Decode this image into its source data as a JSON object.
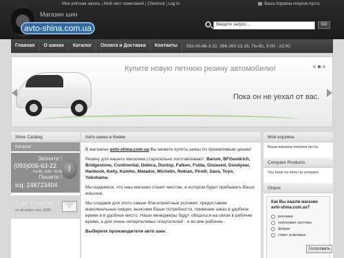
{
  "header": {
    "top_links": [
      "Моя учётная запись",
      "Мой лист пожеланий",
      "Checkout",
      "Log In"
    ],
    "cart_text": "Ваша Корзина покупок пуста.",
    "logo_subtitle": "Магазин шин",
    "logo_main": "avto-shina.com.ua",
    "search_placeholder": "Введите запрос...",
    "go_label": "GO"
  },
  "nav": {
    "items": [
      "Главная",
      "О шинах",
      "Каталог",
      "Оплата и Доставка",
      "Контакты"
    ],
    "info": "093-00-66-3-22, 066-260-13-26, Пн-Вс, 9:00 - 22:00"
  },
  "banner": {
    "line1": "Купите новую летнюю резину автомобилю!",
    "line2": "Пока он не уехал от вас."
  },
  "left": {
    "store_catalog": "Store Catalog",
    "catalog": "Каталог",
    "call": "Звоните !",
    "phone": "(093)006-63-22",
    "hours": "Пн-Вс, 9:00 - 22:00",
    "write": "Пишите !",
    "icq": "icq: 248723404",
    "ship_title": "Free shipping",
    "ship_sub": "on all orders over 100$"
  },
  "center": {
    "heading": "Авто шины в Киеве",
    "p1_pre": "В магазине ",
    "p1_link": "avto-shina.com.ua",
    "p1_post": " Вы можете купить шины по приемлимым ценам!",
    "p2_pre": "Резину для нашего магазина старательно изготавливают: ",
    "p2_brands": "Barum, BFGoodrich, Bridgestone, Continental, Debica, Dunlop, Falken, Fulda, Gislaved, Goodyear, Hankook, Kelly, Kumho, Matador, Michelin, Nokian, Pirelli, Sava, Toyo, Yokohama",
    "p2_post": ".",
    "p3_pre": "Мы надеемся, что наш магазин станет  местом, в котором будет пребывать ",
    "p3_em": "Ваша машина",
    "p3_post": ".",
    "p4": "Мы создаем для этого самые благоприятные условия: предоставим максимальные скидки, выясним Ваши потребности, привезем заказ в удобное время и в удобное место. Наши менеджеры будут общаться на связи в рабочее время, а для очень нетерпеливых покупателей - и во вне рабочее.",
    "choose": "Выберите производителя авто шин:"
  },
  "right": {
    "cart_title": "Моя корзина",
    "cart_msg": "Ваша корзина покупок пуста.",
    "compare_title": "Compare Products",
    "compare_msg": "You have no items to compare.",
    "poll_title": "Опрос",
    "poll_question": "Как Вы нашли магазин avto-shina.com.ua?",
    "poll_options": [
      "реклама",
      "поисковая система",
      "форум",
      "совет знакомых"
    ],
    "vote_label": "Голосовать"
  }
}
